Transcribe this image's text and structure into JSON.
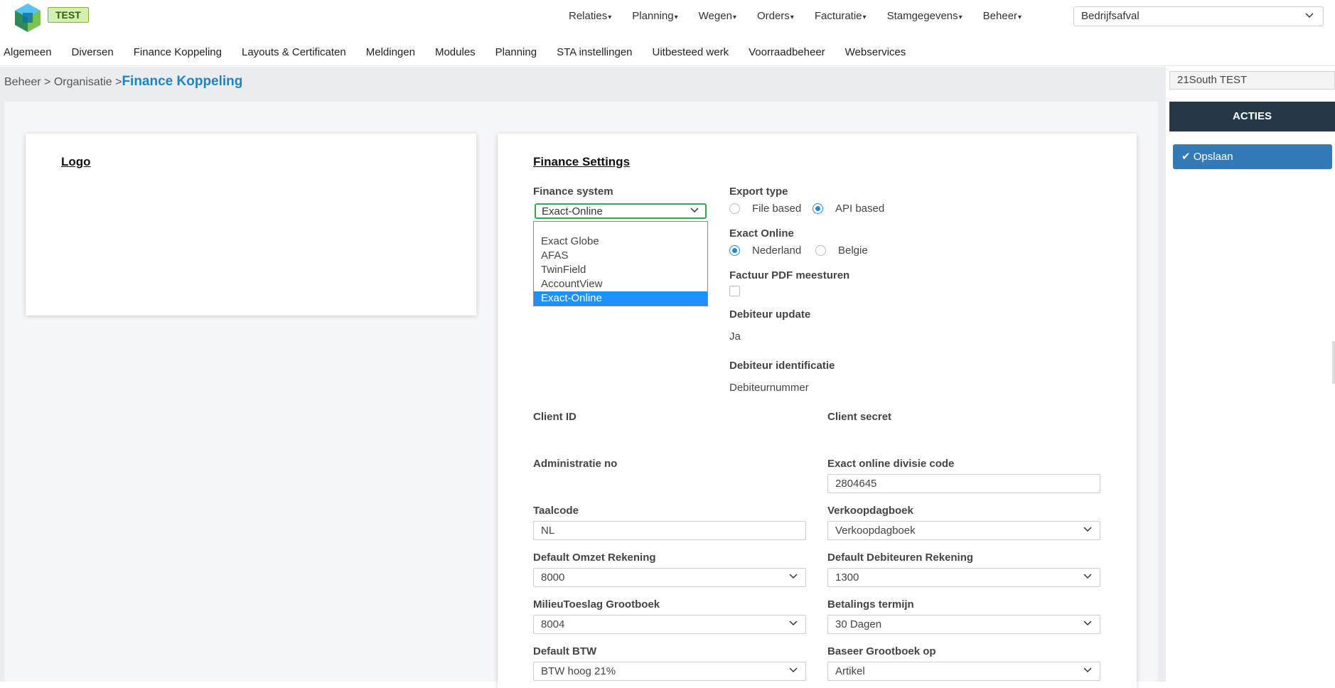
{
  "header": {
    "env_badge": "TEST",
    "menu": [
      {
        "label": "Relaties"
      },
      {
        "label": "Planning"
      },
      {
        "label": "Wegen"
      },
      {
        "label": "Orders"
      },
      {
        "label": "Facturatie"
      },
      {
        "label": "Stamgegevens"
      },
      {
        "label": "Beheer"
      }
    ],
    "company_select": "Bedrijfsafval"
  },
  "subnav": [
    "Algemeen",
    "Diversen",
    "Finance Koppeling",
    "Layouts & Certificaten",
    "Meldingen",
    "Modules",
    "Planning",
    "STA instellingen",
    "Uitbesteed werk",
    "Voorraadbeheer",
    "Webservices"
  ],
  "breadcrumb": {
    "path": "Beheer > Organisatie >",
    "current": "Finance Koppeling"
  },
  "logo_card": {
    "title": "Logo"
  },
  "finance": {
    "title": "Finance Settings",
    "finance_system": {
      "label": "Finance system",
      "value": "Exact-Online",
      "options": [
        "",
        "Exact Globe",
        "AFAS",
        "TwinField",
        "AccountView",
        "Exact-Online"
      ],
      "selected_index": 5
    },
    "export_type": {
      "label": "Export type",
      "options": [
        "File based",
        "API based"
      ],
      "selected": "API based"
    },
    "exact_online": {
      "label": "Exact Online",
      "options": [
        "Nederland",
        "Belgie"
      ],
      "selected": "Nederland"
    },
    "factuur_pdf": {
      "label": "Factuur PDF meesturen",
      "checked": false
    },
    "debiteur_update": {
      "label": "Debiteur update",
      "value": "Ja"
    },
    "debiteur_identificatie": {
      "label": "Debiteur identificatie",
      "value": "Debiteurnummer"
    },
    "client_id": {
      "label": "Client ID"
    },
    "client_secret": {
      "label": "Client secret"
    },
    "administratie_no": {
      "label": "Administratie no"
    },
    "divisie_code": {
      "label": "Exact online divisie code",
      "value": "2804645"
    },
    "taalcode": {
      "label": "Taalcode",
      "value": "NL"
    },
    "verkoopdagboek": {
      "label": "Verkoopdagboek",
      "value": "Verkoopdagboek"
    },
    "omzet_rekening": {
      "label": "Default Omzet Rekening",
      "value": "8000"
    },
    "debiteuren_rekening": {
      "label": "Default Debiteuren Rekening",
      "value": "1300"
    },
    "milieu_toeslag": {
      "label": "MilieuToeslag Grootboek",
      "value": "8004"
    },
    "betalings_termijn": {
      "label": "Betalings termijn",
      "value": "30 Dagen"
    },
    "default_btw": {
      "label": "Default BTW",
      "value": "BTW hoog 21%"
    },
    "baseer_grootboek": {
      "label": "Baseer Grootboek op",
      "value": "Artikel"
    }
  },
  "right_panel": {
    "company": "21South TEST",
    "acties_label": "ACTIES",
    "save_label": "Opslaan"
  },
  "colors": {
    "accent": "#1c84c6",
    "acties_bg": "#243847",
    "save_btn": "#337ab7",
    "selected_option": "#1e90ff",
    "badge_bg": "#d4f0b0"
  }
}
